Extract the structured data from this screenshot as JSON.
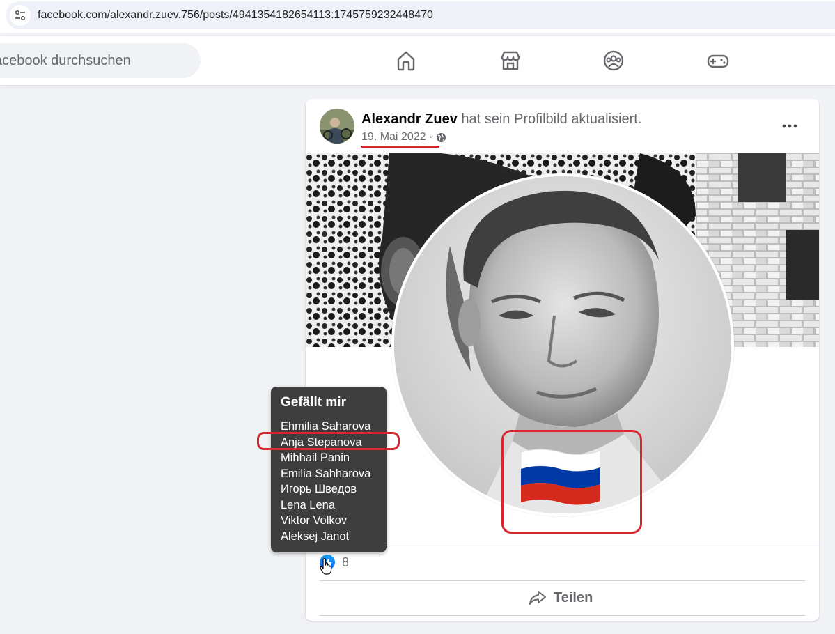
{
  "browser": {
    "url": "facebook.com/alexandr.zuev.756/posts/4941354182654113:1745759232448470"
  },
  "top_nav": {
    "search_placeholder": "acebook durchsuchen",
    "icons": [
      "home-icon",
      "marketplace-icon",
      "groups-icon",
      "gaming-icon"
    ]
  },
  "post": {
    "author": "Alexandr Zuev",
    "action": " hat sein Profilbild aktualisiert.",
    "date": "19. Mai 2022",
    "separator": " · ",
    "privacy_icon": "globe-icon",
    "like_count": "8",
    "share_label": "Teilen"
  },
  "likes_tooltip": {
    "title": "Gefällt mir",
    "names": [
      "Ehmilia Saharova",
      "Anja Stepanova",
      "Mihhail Panin",
      "Emilia Sahharova",
      "Игорь Шведов",
      "Lena Lena",
      "Viktor Volkov",
      "Aleksej Janot"
    ]
  },
  "colors": {
    "annotation_red": "#d7262e",
    "like_blue": "#0866ff",
    "flag_white": "#ffffff",
    "flag_blue": "#0039a6",
    "flag_red": "#d52b1e"
  }
}
